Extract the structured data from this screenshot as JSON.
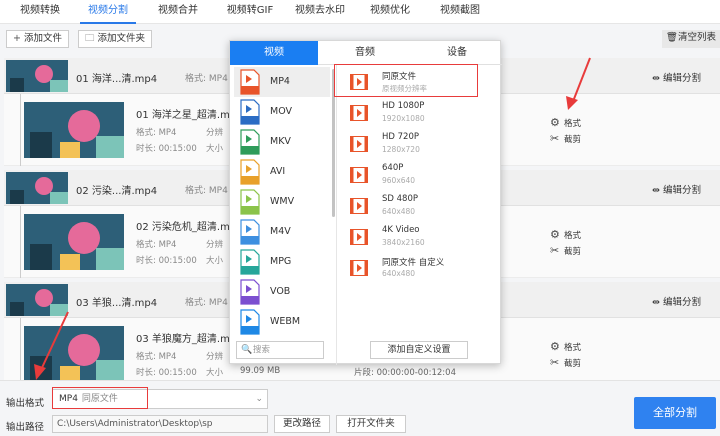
{
  "tabs": [
    "视频转换",
    "视频分割",
    "视频合并",
    "视频转GIF",
    "视频去水印",
    "视频优化",
    "视频截图"
  ],
  "active_tab": 1,
  "toolbar": {
    "add_file": "添加文件",
    "add_folder": "添加文件夹",
    "clear_list": "清空列表"
  },
  "groups": [
    {
      "head_name": "01 海洋...清.mp4",
      "head_format": "格式: MP4",
      "edit_label": "编辑分割",
      "child_name": "01 海洋之星_超清.mp",
      "child_format": "格式: MP4",
      "child_time": "时长: 00:15:00",
      "resolution_label": "分辨",
      "size_label": "大小"
    },
    {
      "head_name": "02 污染...清.mp4",
      "head_format": "格式: MP4",
      "edit_label": "编辑分割",
      "child_name": "02 污染危机_超清.mp",
      "child_format": "格式: MP4",
      "child_time": "时长: 00:15:00",
      "resolution_label": "分辨",
      "size_label": "大小"
    },
    {
      "head_name": "03 羊狼...清.mp4",
      "head_format": "格式: MP4",
      "edit_label": "编辑分割",
      "child_name": "03 羊狼魔方_超清.mp",
      "child_format": "格式: MP4",
      "child_time": "时长: 00:15:00",
      "resolution_label": "分辨",
      "size_label": "大小",
      "extra_size": "99.09 MB",
      "extra_segment": "片段: 00:00:00-00:12:04"
    }
  ],
  "row_actions": {
    "format": "格式",
    "cut": "截剪"
  },
  "bottom": {
    "output_format_label": "输出格式",
    "output_format_value": "MP4",
    "output_format_sub": "同原文件",
    "output_path_label": "输出路径",
    "output_path_value": "C:\\Users\\Administrator\\Desktop\\sp",
    "change_path": "更改路径",
    "open_folder": "打开文件夹",
    "split_all": "全部分割"
  },
  "popup": {
    "tabs": [
      "视频",
      "音频",
      "设备"
    ],
    "active_tab": 0,
    "formats": [
      {
        "name": "MP4",
        "color": "#e8542a"
      },
      {
        "name": "MOV",
        "color": "#2b6cc4"
      },
      {
        "name": "MKV",
        "color": "#2f9c5a"
      },
      {
        "name": "AVI",
        "color": "#e8a02a"
      },
      {
        "name": "WMV",
        "color": "#8bc34a"
      },
      {
        "name": "M4V",
        "color": "#3d8fe0"
      },
      {
        "name": "MPG",
        "color": "#26a69a"
      },
      {
        "name": "VOB",
        "color": "#7b4fd0"
      },
      {
        "name": "WEBM",
        "color": "#1e88e5"
      }
    ],
    "selected_format": 0,
    "search_placeholder": "搜索",
    "resolutions": [
      {
        "title": "同原文件",
        "sub": "原视频分辨率"
      },
      {
        "title": "HD 1080P",
        "sub": "1920x1080"
      },
      {
        "title": "HD 720P",
        "sub": "1280x720"
      },
      {
        "title": "640P",
        "sub": "960x640"
      },
      {
        "title": "SD 480P",
        "sub": "640x480"
      },
      {
        "title": "4K Video",
        "sub": "3840x2160"
      },
      {
        "title": "同原文件 自定义",
        "sub": "640x480"
      }
    ],
    "custom_button": "添加自定义设置"
  },
  "colors": {
    "accent": "#2f82f0",
    "highlight": "#e83b3b",
    "film_icon": "#e8542a"
  }
}
